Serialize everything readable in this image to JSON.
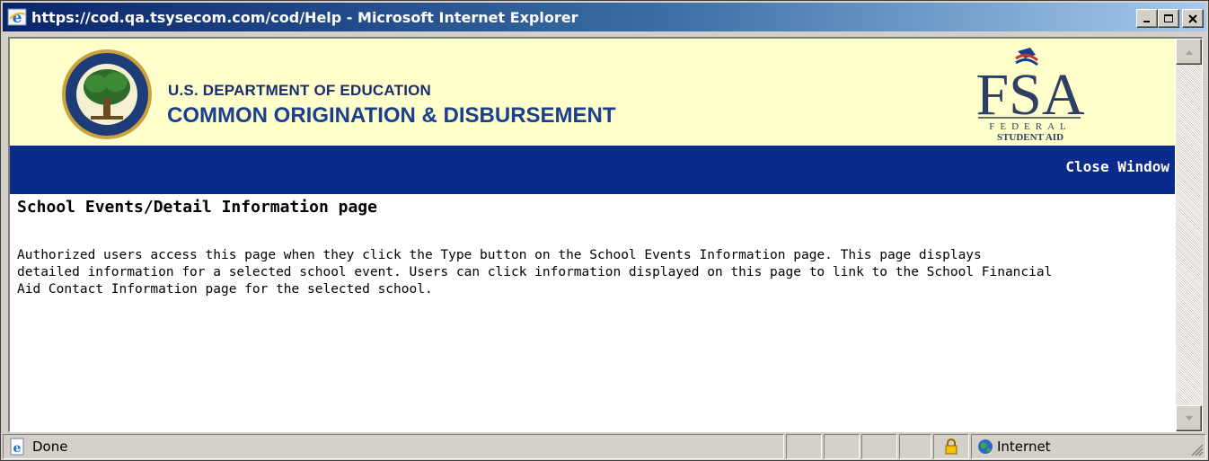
{
  "window": {
    "title": "https://cod.qa.tsysecom.com/cod/Help - Microsoft Internet Explorer",
    "minimize_icon": "minimize-icon",
    "maximize_icon": "maximize-icon",
    "close_icon": "close-icon"
  },
  "header": {
    "department": "U.S. DEPARTMENT OF EDUCATION",
    "program": "COMMON ORIGINATION & DISBURSEMENT",
    "seal_alt": "department-of-education-seal",
    "logo_alt": "fsa-federal-student-aid-logo",
    "logo_letters": "FSA",
    "logo_federal": "FEDERAL",
    "logo_student_aid": "STUDENT AID",
    "background_color": "#ffffcc"
  },
  "navbar": {
    "close_label": "Close Window",
    "background_color": "#0a2a8c"
  },
  "content": {
    "heading": "School Events/Detail Information page",
    "body_lines": [
      "Authorized users access this page when they click the Type button on the School Events Information page. This page displays",
      "detailed information for a selected school event. Users can click information displayed on this page to link to the School Financial",
      "Aid Contact Information page for the selected school."
    ]
  },
  "statusbar": {
    "status_text": "Done",
    "zone_text": "Internet",
    "security_icon": "lock-icon",
    "zone_icon": "globe-icon"
  }
}
